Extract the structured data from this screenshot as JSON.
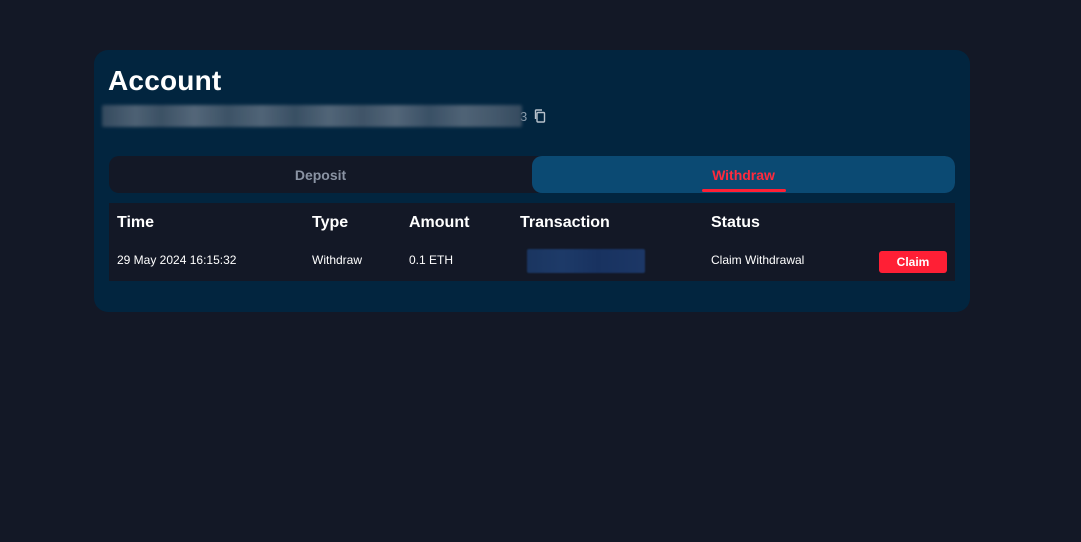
{
  "account": {
    "title": "Account",
    "address_tail": "3",
    "copy_icon": "copy-icon"
  },
  "tabs": [
    {
      "label": "Deposit",
      "active": false
    },
    {
      "label": "Withdraw",
      "active": true
    }
  ],
  "table": {
    "headers": {
      "time": "Time",
      "type": "Type",
      "amount": "Amount",
      "transaction": "Transaction",
      "status": "Status"
    },
    "rows": [
      {
        "time": "29 May 2024 16:15:32",
        "type": "Withdraw",
        "amount": "0.1 ETH",
        "status": "Claim Withdrawal",
        "action_label": "Claim"
      }
    ]
  },
  "colors": {
    "background": "#131826",
    "card": "#02253f",
    "active_tab": "#0b4a73",
    "accent_red": "#ff1f35",
    "inactive_tab_text": "#8a93a3"
  }
}
